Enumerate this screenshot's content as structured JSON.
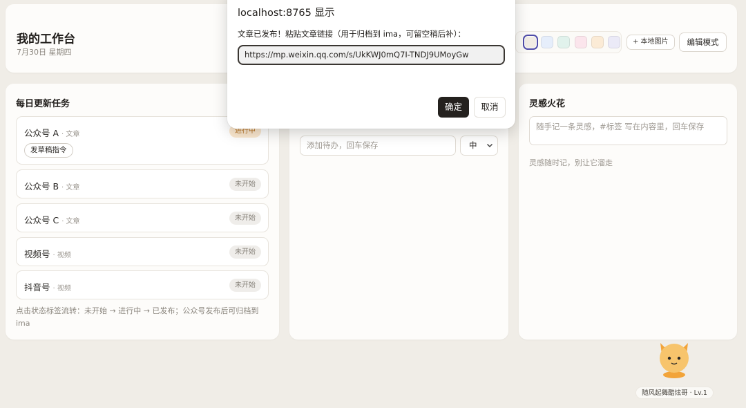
{
  "header": {
    "title": "我的工作台",
    "date": "7月30日 星期四",
    "swatches": [
      {
        "color": "#f1ece4",
        "selected": true
      },
      {
        "color": "#e6eefb",
        "selected": false
      },
      {
        "color": "#e1f2ec",
        "selected": false
      },
      {
        "color": "#fbe5ec",
        "selected": false
      },
      {
        "color": "#fbebd6",
        "selected": false
      },
      {
        "color": "#ebeaf7",
        "selected": false
      }
    ],
    "local_image_label": "+ 本地图片",
    "edit_mode_label": "编辑模式"
  },
  "daily_tasks": {
    "title": "每日更新任务",
    "items": [
      {
        "name": "公众号 A",
        "type": "· 文章",
        "status": "进行中",
        "status_kind": "active",
        "action": "发草稿指令"
      },
      {
        "name": "公众号 B",
        "type": "· 文章",
        "status": "未开始",
        "status_kind": "pending"
      },
      {
        "name": "公众号 C",
        "type": "· 文章",
        "status": "未开始",
        "status_kind": "pending"
      },
      {
        "name": "视频号",
        "type": "· 视频",
        "status": "未开始",
        "status_kind": "pending"
      },
      {
        "name": "抖音号",
        "type": "· 视频",
        "status": "未开始",
        "status_kind": "pending"
      }
    ],
    "hint": "点击状态标签流转：未开始 → 进行中 → 已发布；公众号发布后可归档到 ima"
  },
  "todo": {
    "input_placeholder": "添加待办，回车保存",
    "priority_value": "中"
  },
  "inspiration": {
    "title": "灵感火花",
    "input_placeholder": "随手记一条灵感，#标签 写在内容里，回车保存",
    "empty_text": "灵感随时记，别让它溜走"
  },
  "mascot": {
    "level_label": "随风起舞酷炫哥 · Lv.1"
  },
  "dialog": {
    "title": "localhost:8765 显示",
    "message": "文章已发布！粘贴文章链接（用于归档到 ima，可留空稍后补）：",
    "input_value": "https://mp.weixin.qq.com/s/UkKWJ0mQ7I-TNDJ9UMoyGw",
    "ok_label": "确定",
    "cancel_label": "取消"
  }
}
